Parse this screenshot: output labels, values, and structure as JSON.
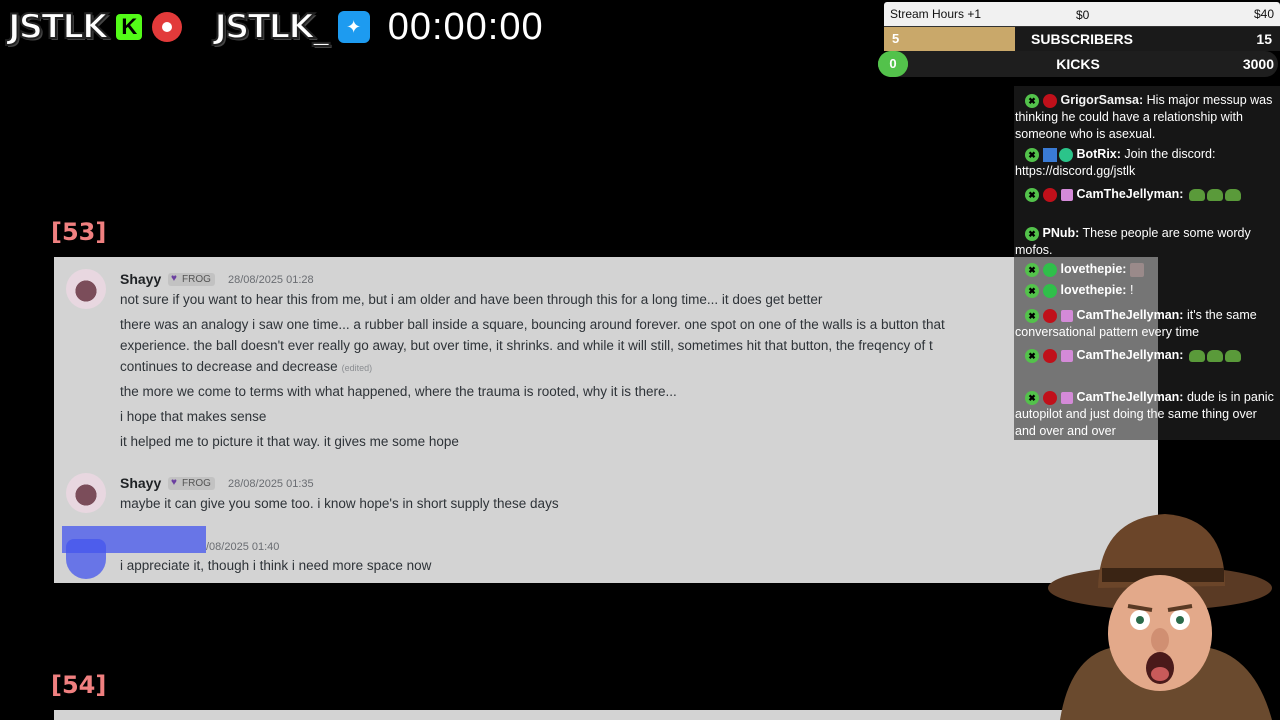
{
  "overlay": {
    "brand1": "JSTLK",
    "brand2": "JSTLK_",
    "timer": "00:00:00"
  },
  "goals": {
    "stream_hours_label": "Stream Hours +1",
    "stream_hours_start": "$0",
    "stream_hours_end": "$40",
    "subscribers_count": "5",
    "subscribers_label": "SUBSCRIBERS",
    "subscribers_goal": "15",
    "subscribers_progress": 0.33,
    "kicks_count": "0",
    "kicks_label": "KICKS",
    "kicks_goal": "3000",
    "kicks_progress": 0.0
  },
  "sections": [
    "[53]",
    "[54]"
  ],
  "discord": {
    "groups": [
      {
        "username": "Shayy",
        "role": "FROG",
        "timestamp": "28/08/2025 01:28",
        "lines": [
          "not sure if you want to hear this from me, but i am older and have been through this for a long time... it does get better",
          "there was an analogy i saw one time... a rubber ball inside a square, bouncing around forever. one spot on one of the walls is a button that",
          "experience. the ball doesn't ever really go away, but over time, it shrinks. and while it will still, sometimes hit that button, the freqency of t",
          "continues to decrease and decrease",
          "the more we come to terms with what happened, where the trauma is rooted, why it is there...",
          "i hope that makes sense",
          "it helped me to picture it that way. it gives me some hope"
        ],
        "edited": "(edited)"
      },
      {
        "username": "Shayy",
        "role": "FROG",
        "timestamp": "28/08/2025 01:35",
        "lines": [
          "maybe it can give you some too. i know hope's in short supply these days"
        ]
      },
      {
        "username": "",
        "timestamp": "/08/2025 01:40",
        "lines": [
          "i appreciate it, though i think i need more space now"
        ]
      }
    ]
  },
  "chat": [
    {
      "name": "GrigorSamsa:",
      "text": "His major messup was thinking he could have a relationship with someone who is asexual."
    },
    {
      "name": "BotRix:",
      "text": "Join the discord: https://discord.gg/jstlk"
    },
    {
      "name": "CamTheJellyman:",
      "text": ""
    },
    {
      "name": "PNub:",
      "text": "These people are some wordy mofos."
    },
    {
      "name": "lovethepie:",
      "text": ""
    },
    {
      "name": "lovethepie:",
      "text": "!"
    },
    {
      "name": "CamTheJellyman:",
      "text": "it's the same conversational pattern every time"
    },
    {
      "name": "CamTheJellyman:",
      "text": ""
    },
    {
      "name": "CamTheJellyman:",
      "text": "dude is in panic autopilot and just doing the same thing over and over and over"
    }
  ],
  "colors": {
    "accent_green": "#53c24b",
    "subs_fill": "#c9a86a",
    "section_red": "#f08080",
    "card_bg": "#d3d3d3"
  }
}
